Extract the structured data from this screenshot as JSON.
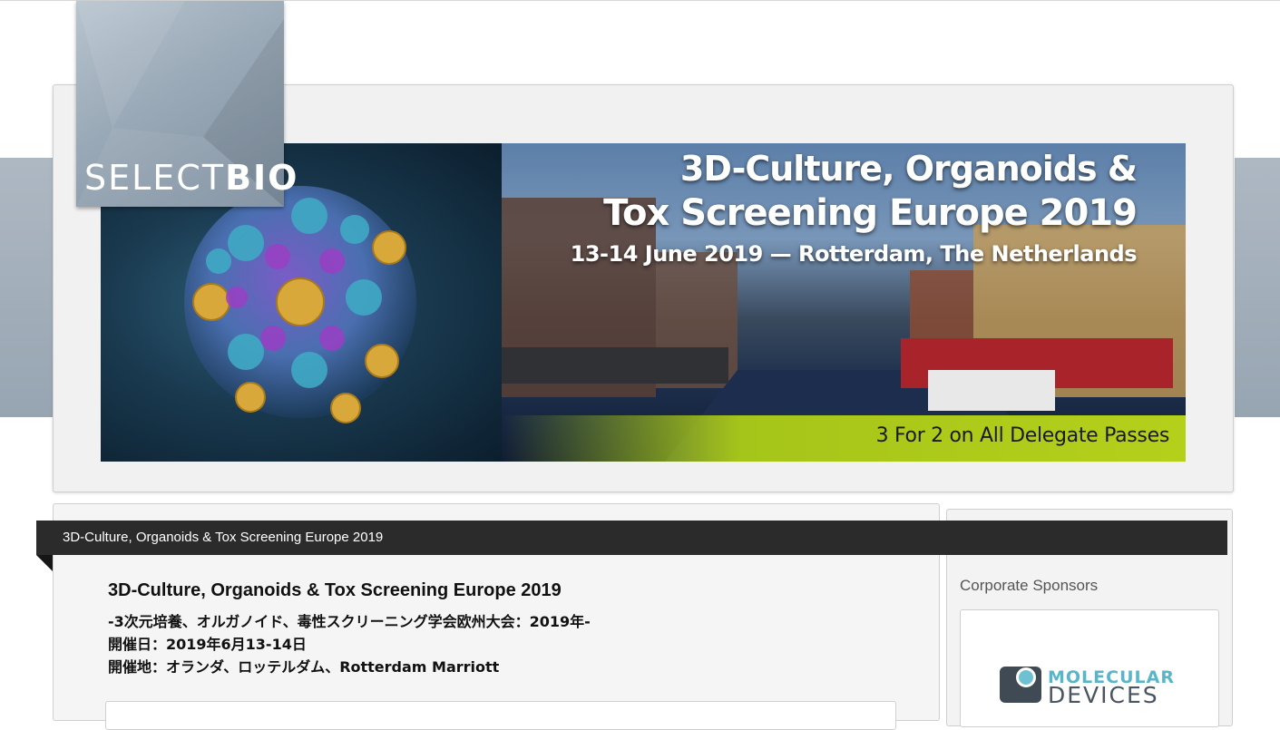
{
  "brand": {
    "logo_light": "SELECT",
    "logo_bold": "BIO"
  },
  "banner": {
    "title_line1": "3D-Culture, Organoids &",
    "title_line2": "Tox Screening Europe 2019",
    "dates_location": "13-14 June 2019 — Rotterdam, The Netherlands",
    "promo": "3 For 2 on All Delegate Passes"
  },
  "page": {
    "title_bar": "3D-Culture, Organoids & Tox Screening Europe 2019",
    "heading": "3D-Culture, Organoids & Tox Screening Europe 2019",
    "subtitle": "-3次元培養、オルガノイド、毒性スクリーニング学会欧州大会：2019年-",
    "date_line": "開催日：2019年6月13-14日",
    "venue_line": "開催地：オランダ、ロッテルダム、Rotterdam Marriott"
  },
  "sidebar": {
    "heading": "Corporate Sponsors",
    "sponsor": {
      "name_line1": "MOLECULAR",
      "name_line2": "DEVICES"
    }
  },
  "colors": {
    "title_bar_bg": "#2b2b2b",
    "promo_green": "#b5d01b",
    "sponsor_teal": "#5bb5c9",
    "logo_grey": "#9aa9b7"
  }
}
